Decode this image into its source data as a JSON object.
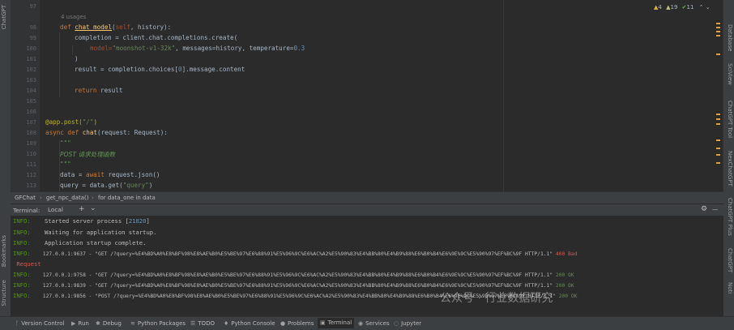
{
  "left_tabs": [
    "ChatGPT",
    "Bookmarks",
    "Structure"
  ],
  "right_tabs": [
    "Database",
    "SciView",
    "ChatGPT Tool",
    "NexChatGPT",
    "ChatGPT Plus",
    "ChatGPT",
    "Noti"
  ],
  "editor": {
    "line_numbers": [
      "97",
      "98",
      "99",
      "100",
      "101",
      "102",
      "103",
      "104",
      "105",
      "106",
      "107",
      "108",
      "109",
      "110",
      "111",
      "112",
      "113"
    ],
    "usages": "4 usages",
    "inspections": {
      "warnings": "4",
      "weak_warnings": "19",
      "ok": "11"
    },
    "lines": {
      "l98_kw": "def ",
      "l98_fn": "chat_model",
      "l98_a": "(",
      "l98_self": "self",
      "l98_b": ", history):",
      "l99": "completion = client.chat.completions.create(",
      "l100_a": "model=",
      "l100_str": "\"moonshot-v1-32k\"",
      "l100_b": ", messages=history, temperature=",
      "l100_num": "0.3",
      "l101": ")",
      "l102_a": "result = completion.choices[",
      "l102_num": "0",
      "l102_b": "].message.content",
      "l104_kw": "return ",
      "l104_b": "result",
      "l107_deco": "@app.post(",
      "l107_str": "\"/\"",
      "l107_b": ")",
      "l108_kw": "async def ",
      "l108_fn": "chat",
      "l108_b": "(request: Request):",
      "l109": "\"\"\"",
      "l110": "POST 请求处理函数",
      "l111": "\"\"\"",
      "l112_a": "data = ",
      "l112_kw": "await ",
      "l112_b": "request.json()",
      "l113_a": "query = data.get(",
      "l113_str": "\"query\"",
      "l113_b": ")"
    }
  },
  "breadcrumb": [
    "GFChat",
    "get_npc_data()",
    "for data_one in data"
  ],
  "terminal": {
    "title": "Terminal:",
    "tab": "Local",
    "add": "+",
    "dropdown": "⌄",
    "settings": "⚙",
    "minimize": "—",
    "lines": [
      {
        "level": "INFO:",
        "text": "    Started server process [",
        "pid": "21820",
        "end": "]"
      },
      {
        "level": "INFO:",
        "text": "    Waiting for application startup."
      },
      {
        "level": "INFO:",
        "text": "    Application startup complete."
      },
      {
        "level": "INFO:",
        "text": "    127.0.0.1:9637 - \"GET /?query=%E4%BD%A0%E8%BF%98%E8%AE%B0%E5%BE%97%E6%88%91%E5%96%9C%E6%AC%A2%E5%90%83%E4%BB%80%E4%B9%88%E6%B0%B4%E6%9E%9C%E5%90%97%EF%BC%9F HTTP/1.1\" ",
        "status": "400 Bad",
        "cont": " Request"
      },
      {
        "level": "INFO:",
        "text": "    127.0.0.1:9758 - \"GET /?query=%E4%BD%A0%E8%BF%98%E8%AE%B0%E5%BE%97%E6%88%91%E5%96%9C%E6%AC%A2%E5%90%83%E4%BB%80%E4%B9%88%E6%B0%B4%E6%9E%9C%E5%90%97%EF%BC%9F HTTP/1.1\" ",
        "status": "200 OK"
      },
      {
        "level": "INFO:",
        "text": "    127.0.0.1:9839 - \"GET /?query=%E4%BD%A0%E8%BF%98%E8%AE%B0%E5%BE%97%E6%88%91%E5%96%9C%E6%AC%A2%E5%90%83%E4%BB%80%E4%B9%88%E6%B0%B4%E6%9E%9C%E5%90%97%EF%BC%9F HTTP/1.1\" ",
        "status": "200 OK"
      },
      {
        "level": "INFO:",
        "text": "    127.0.0.1:9856 - \"POST /?query=%E4%BD%A0%E8%BF%98%E8%AE%B0%E5%BE%97%E6%88%91%E5%96%9C%E6%AC%A2%E5%90%83%E4%BB%80%E4%B9%88%E6%B0%B4%E6%9E%9C%E5%90%97%EF%BC%9F HTTP/1.1\" ",
        "status": "200 OK"
      }
    ],
    "watermark": "公众号 · 行业数据研究"
  },
  "bottom_bar": [
    "Version Control",
    "Run",
    "Debug",
    "Python Packages",
    "TODO",
    "Python Console",
    "Problems",
    "Terminal",
    "Services",
    "Jupyter"
  ],
  "colors": {
    "accent": "#4a88c7",
    "info": "#4e9a06",
    "error": "#cf5b56",
    "ok": "#6a8759"
  }
}
